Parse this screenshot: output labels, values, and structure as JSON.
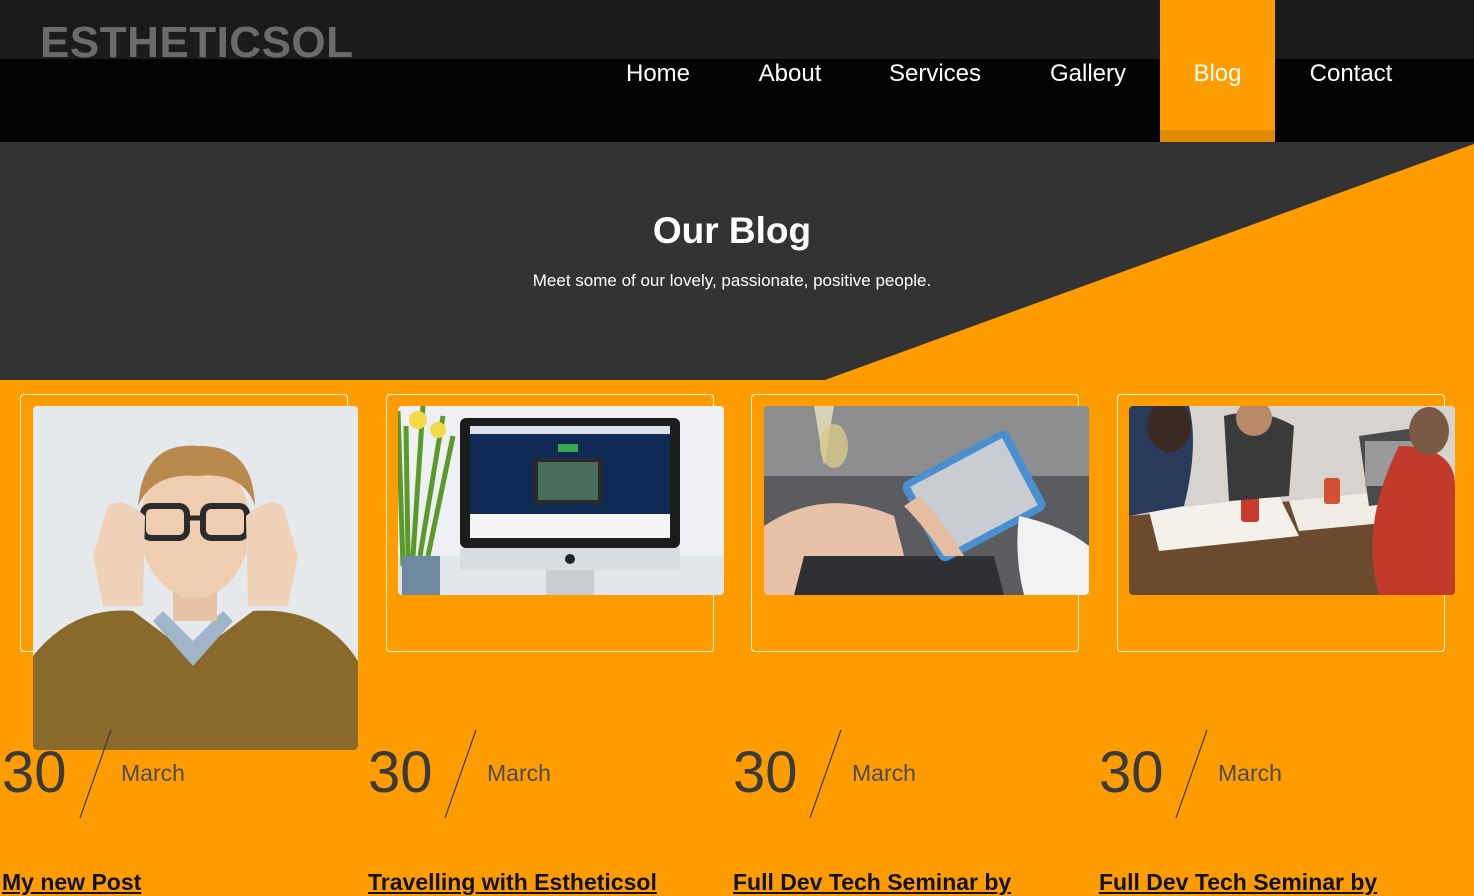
{
  "brand": "ESTHETICSOL",
  "nav": {
    "items": [
      {
        "label": "Home"
      },
      {
        "label": "About"
      },
      {
        "label": "Services"
      },
      {
        "label": "Gallery"
      },
      {
        "label": "Blog"
      },
      {
        "label": "Contact"
      }
    ],
    "active": "Blog"
  },
  "hero": {
    "title": "Our Blog",
    "subtitle": "Meet some of our lovely, passionate, positive people."
  },
  "posts": [
    {
      "day": "30",
      "month": "March",
      "title": "My new Post",
      "image": "man-with-glasses-photo"
    },
    {
      "day": "30",
      "month": "March",
      "title": "Travelling with Estheticsol",
      "image": "imac-desktop-photo"
    },
    {
      "day": "30",
      "month": "March",
      "title": "Full Dev Tech Seminar by",
      "image": "tablet-hands-photo"
    },
    {
      "day": "30",
      "month": "March",
      "title": "Full Dev Tech Seminar by",
      "image": "team-meeting-photo"
    }
  ],
  "colors": {
    "accent": "#ff9d00",
    "header_top": "#1b1b1b",
    "navbar": "#030303",
    "hero_dark": "#333333"
  }
}
